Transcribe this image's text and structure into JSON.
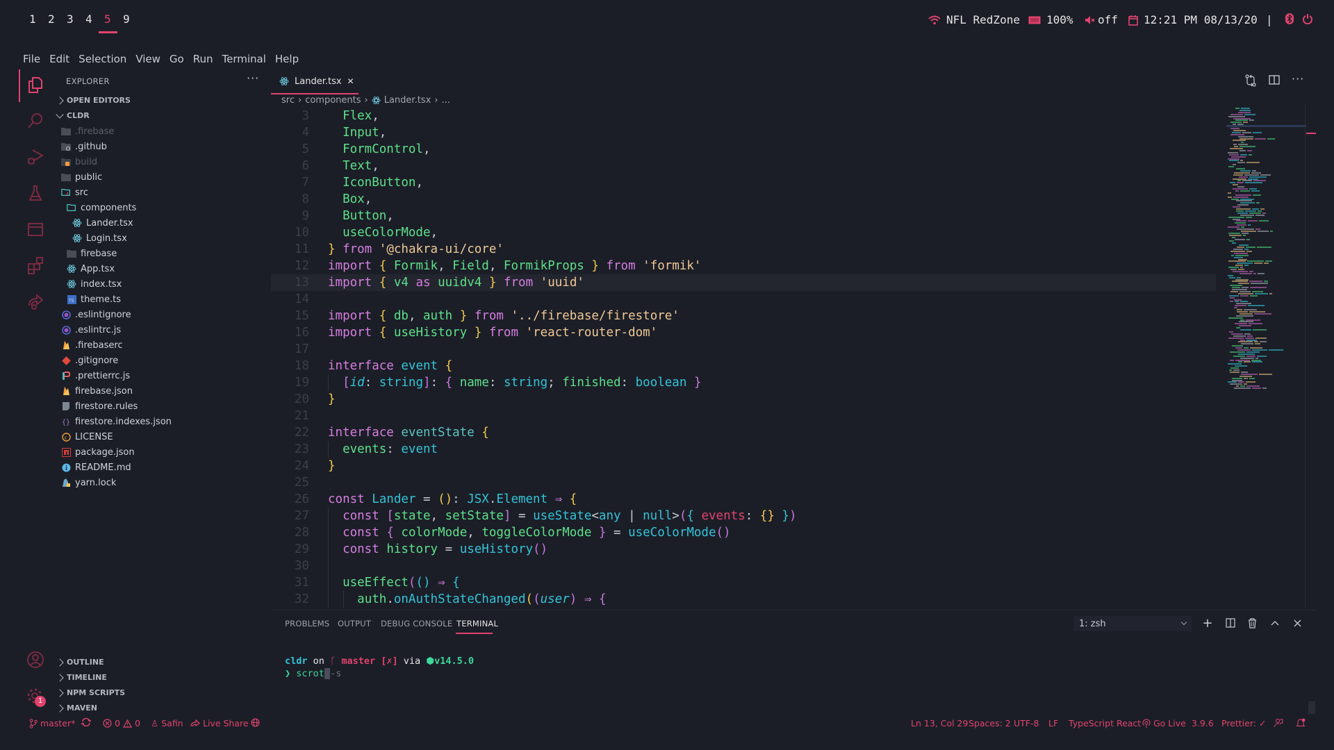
{
  "workspaces": {
    "items": [
      "1",
      "2",
      "3",
      "4",
      "5",
      "9"
    ],
    "active": "5"
  },
  "system_tray": {
    "wifi_name": "NFL RedZone",
    "battery": "100%",
    "volume": "off",
    "datetime": "12:21 PM 08/13/20",
    "separator": "|"
  },
  "menu": [
    "File",
    "Edit",
    "Selection",
    "View",
    "Go",
    "Run",
    "Terminal",
    "Help"
  ],
  "activity_bar": {
    "items": [
      "explorer",
      "search",
      "run-debug",
      "testing",
      "remote-explorer",
      "extensions",
      "live-share"
    ],
    "settings_badge": "1"
  },
  "explorer": {
    "title": "EXPLORER",
    "more": "···",
    "open_editors": "OPEN EDITORS",
    "root": "CLDR",
    "tree": [
      {
        "name": ".firebase",
        "kind": "folder",
        "dim": true
      },
      {
        "name": ".github",
        "kind": "folder-github"
      },
      {
        "name": "build",
        "kind": "folder-build",
        "dim": true
      },
      {
        "name": "public",
        "kind": "folder"
      },
      {
        "name": "src",
        "kind": "folder-src-open"
      },
      {
        "name": "components",
        "kind": "folder-open"
      },
      {
        "name": "Lander.tsx",
        "kind": "react"
      },
      {
        "name": "Login.tsx",
        "kind": "react"
      },
      {
        "name": "firebase",
        "kind": "folder"
      },
      {
        "name": "App.tsx",
        "kind": "react"
      },
      {
        "name": "index.tsx",
        "kind": "react"
      },
      {
        "name": "theme.ts",
        "kind": "typescript"
      },
      {
        "name": ".eslintignore",
        "kind": "eslint"
      },
      {
        "name": ".eslintrc.js",
        "kind": "eslint"
      },
      {
        "name": ".firebaserc",
        "kind": "firebase"
      },
      {
        "name": ".gitignore",
        "kind": "git"
      },
      {
        "name": ".prettierrc.js",
        "kind": "prettier"
      },
      {
        "name": "firebase.json",
        "kind": "firebase"
      },
      {
        "name": "firestore.rules",
        "kind": "file"
      },
      {
        "name": "firestore.indexes.json",
        "kind": "json"
      },
      {
        "name": "LICENSE",
        "kind": "license"
      },
      {
        "name": "package.json",
        "kind": "npm"
      },
      {
        "name": "README.md",
        "kind": "info"
      },
      {
        "name": "yarn.lock",
        "kind": "yarn"
      }
    ],
    "bottom_sections": [
      "OUTLINE",
      "TIMELINE",
      "NPM SCRIPTS",
      "MAVEN"
    ]
  },
  "editor": {
    "tab": {
      "label": "Lander.tsx",
      "close": "✕"
    },
    "breadcrumb": [
      "src",
      "components",
      "Lander.tsx",
      "..."
    ],
    "current_line": 13,
    "lines": [
      {
        "n": "3",
        "tokens": [
          [
            "g",
            "  Flex"
          ],
          [
            "p",
            ","
          ]
        ]
      },
      {
        "n": "4",
        "tokens": [
          [
            "g",
            "  Input"
          ],
          [
            "p",
            ","
          ]
        ]
      },
      {
        "n": "5",
        "tokens": [
          [
            "g",
            "  FormControl"
          ],
          [
            "p",
            ","
          ]
        ]
      },
      {
        "n": "6",
        "tokens": [
          [
            "g",
            "  Text"
          ],
          [
            "p",
            ","
          ]
        ]
      },
      {
        "n": "7",
        "tokens": [
          [
            "g",
            "  IconButton"
          ],
          [
            "p",
            ","
          ]
        ]
      },
      {
        "n": "8",
        "tokens": [
          [
            "g",
            "  Box"
          ],
          [
            "p",
            ","
          ]
        ]
      },
      {
        "n": "9",
        "tokens": [
          [
            "g",
            "  Button"
          ],
          [
            "p",
            ","
          ]
        ]
      },
      {
        "n": "10",
        "tokens": [
          [
            "g",
            "  useColorMode"
          ],
          [
            "p",
            ","
          ]
        ]
      },
      {
        "n": "11",
        "tokens": [
          [
            "b",
            "}"
          ],
          [
            "p",
            " "
          ],
          [
            "k",
            "from"
          ],
          [
            "p",
            " "
          ],
          [
            "s",
            "'@chakra-ui/core'"
          ]
        ]
      },
      {
        "n": "12",
        "tokens": [
          [
            "k",
            "import"
          ],
          [
            "p",
            " "
          ],
          [
            "b",
            "{"
          ],
          [
            "p",
            " "
          ],
          [
            "g",
            "Formik"
          ],
          [
            "p",
            ", "
          ],
          [
            "g",
            "Field"
          ],
          [
            "p",
            ", "
          ],
          [
            "g",
            "FormikProps"
          ],
          [
            "p",
            " "
          ],
          [
            "b",
            "}"
          ],
          [
            "p",
            " "
          ],
          [
            "k",
            "from"
          ],
          [
            "p",
            " "
          ],
          [
            "s",
            "'formik'"
          ]
        ]
      },
      {
        "n": "13",
        "tokens": [
          [
            "k",
            "import"
          ],
          [
            "p",
            " "
          ],
          [
            "b",
            "{"
          ],
          [
            "p",
            " "
          ],
          [
            "g",
            "v4"
          ],
          [
            "p",
            " "
          ],
          [
            "k",
            "as"
          ],
          [
            "p",
            " "
          ],
          [
            "g",
            "uuidv4"
          ],
          [
            "p",
            " "
          ],
          [
            "b",
            "}"
          ],
          [
            "p",
            " "
          ],
          [
            "k",
            "from"
          ],
          [
            "p",
            " "
          ],
          [
            "s",
            "'uuid'"
          ]
        ]
      },
      {
        "n": "14",
        "tokens": []
      },
      {
        "n": "15",
        "tokens": [
          [
            "k",
            "import"
          ],
          [
            "p",
            " "
          ],
          [
            "b",
            "{"
          ],
          [
            "p",
            " "
          ],
          [
            "g",
            "db"
          ],
          [
            "p",
            ", "
          ],
          [
            "g",
            "auth"
          ],
          [
            "p",
            " "
          ],
          [
            "b",
            "}"
          ],
          [
            "p",
            " "
          ],
          [
            "k",
            "from"
          ],
          [
            "p",
            " "
          ],
          [
            "s",
            "'../firebase/firestore'"
          ]
        ]
      },
      {
        "n": "16",
        "tokens": [
          [
            "k",
            "import"
          ],
          [
            "p",
            " "
          ],
          [
            "b",
            "{"
          ],
          [
            "p",
            " "
          ],
          [
            "g",
            "useHistory"
          ],
          [
            "p",
            " "
          ],
          [
            "b",
            "}"
          ],
          [
            "p",
            " "
          ],
          [
            "k",
            "from"
          ],
          [
            "p",
            " "
          ],
          [
            "s",
            "'react-router-dom'"
          ]
        ]
      },
      {
        "n": "17",
        "tokens": []
      },
      {
        "n": "18",
        "tokens": [
          [
            "k",
            "interface"
          ],
          [
            "p",
            " "
          ],
          [
            "t",
            "event"
          ],
          [
            "p",
            " "
          ],
          [
            "b",
            "{"
          ]
        ]
      },
      {
        "n": "19",
        "tokens": [
          [
            "p",
            "  "
          ],
          [
            "m",
            "["
          ],
          [
            "t it",
            "id"
          ],
          [
            "p",
            ": "
          ],
          [
            "t",
            "string"
          ],
          [
            "m",
            "]"
          ],
          [
            "p",
            ": "
          ],
          [
            "m",
            "{"
          ],
          [
            "p",
            " "
          ],
          [
            "g",
            "name"
          ],
          [
            "p",
            ": "
          ],
          [
            "t",
            "string"
          ],
          [
            "p",
            "; "
          ],
          [
            "g",
            "finished"
          ],
          [
            "p",
            ": "
          ],
          [
            "t",
            "boolean"
          ],
          [
            "p",
            " "
          ],
          [
            "m",
            "}"
          ]
        ]
      },
      {
        "n": "20",
        "tokens": [
          [
            "b",
            "}"
          ]
        ]
      },
      {
        "n": "21",
        "tokens": []
      },
      {
        "n": "22",
        "tokens": [
          [
            "k",
            "interface"
          ],
          [
            "p",
            " "
          ],
          [
            "tc",
            "eventState"
          ],
          [
            "p",
            " "
          ],
          [
            "b",
            "{"
          ]
        ]
      },
      {
        "n": "23",
        "tokens": [
          [
            "g",
            "  events"
          ],
          [
            "p",
            ": "
          ],
          [
            "t",
            "event"
          ]
        ]
      },
      {
        "n": "24",
        "tokens": [
          [
            "b",
            "}"
          ]
        ]
      },
      {
        "n": "25",
        "tokens": []
      },
      {
        "n": "26",
        "tokens": [
          [
            "k",
            "const"
          ],
          [
            "p",
            " "
          ],
          [
            "t",
            "Lander"
          ],
          [
            "p",
            " = "
          ],
          [
            "b",
            "()"
          ],
          [
            "p",
            ": "
          ],
          [
            "t",
            "JSX"
          ],
          [
            "p",
            "."
          ],
          [
            "t",
            "Element"
          ],
          [
            "p",
            " "
          ],
          [
            "k",
            "⇒"
          ],
          [
            "p",
            " "
          ],
          [
            "b",
            "{"
          ]
        ]
      },
      {
        "n": "27",
        "tokens": [
          [
            "p",
            "  "
          ],
          [
            "k",
            "const"
          ],
          [
            "p",
            " "
          ],
          [
            "m",
            "["
          ],
          [
            "g",
            "state"
          ],
          [
            "p",
            ", "
          ],
          [
            "g",
            "setState"
          ],
          [
            "m",
            "]"
          ],
          [
            "p",
            " = "
          ],
          [
            "t",
            "useState"
          ],
          [
            "p",
            "<"
          ],
          [
            "t",
            "any"
          ],
          [
            "p",
            " | "
          ],
          [
            "t",
            "null"
          ],
          [
            "p",
            ">"
          ],
          [
            "m",
            "("
          ],
          [
            "t",
            "{"
          ],
          [
            "p",
            " "
          ],
          [
            "r",
            "events"
          ],
          [
            "p",
            ": "
          ],
          [
            "b",
            "{}"
          ],
          [
            "p",
            " "
          ],
          [
            "t",
            "}"
          ],
          [
            "m",
            ")"
          ]
        ]
      },
      {
        "n": "28",
        "tokens": [
          [
            "p",
            "  "
          ],
          [
            "k",
            "const"
          ],
          [
            "p",
            " "
          ],
          [
            "m",
            "{"
          ],
          [
            "p",
            " "
          ],
          [
            "g",
            "colorMode"
          ],
          [
            "p",
            ", "
          ],
          [
            "g",
            "toggleColorMode"
          ],
          [
            "p",
            " "
          ],
          [
            "m",
            "}"
          ],
          [
            "p",
            " = "
          ],
          [
            "t",
            "useColorMode"
          ],
          [
            "m",
            "()"
          ]
        ]
      },
      {
        "n": "29",
        "tokens": [
          [
            "p",
            "  "
          ],
          [
            "k",
            "const"
          ],
          [
            "p",
            " "
          ],
          [
            "g",
            "history"
          ],
          [
            "p",
            " = "
          ],
          [
            "t",
            "useHistory"
          ],
          [
            "m",
            "()"
          ]
        ]
      },
      {
        "n": "30",
        "tokens": []
      },
      {
        "n": "31",
        "tokens": [
          [
            "p",
            "  "
          ],
          [
            "g",
            "useEffect"
          ],
          [
            "m",
            "("
          ],
          [
            "t",
            "()"
          ],
          [
            "p",
            " "
          ],
          [
            "k",
            "⇒"
          ],
          [
            "p",
            " "
          ],
          [
            "t",
            "{"
          ]
        ]
      },
      {
        "n": "32",
        "tokens": [
          [
            "p",
            "    "
          ],
          [
            "g",
            "auth"
          ],
          [
            "p",
            "."
          ],
          [
            "t",
            "onAuthStateChanged"
          ],
          [
            "b",
            "("
          ],
          [
            "m",
            "("
          ],
          [
            "t it",
            "user"
          ],
          [
            "m",
            ")"
          ],
          [
            "p",
            " "
          ],
          [
            "k",
            "⇒"
          ],
          [
            "p",
            " "
          ],
          [
            "m",
            "{"
          ]
        ]
      }
    ]
  },
  "panel": {
    "tabs": [
      "PROBLEMS",
      "OUTPUT",
      "DEBUG CONSOLE",
      "TERMINAL"
    ],
    "active_tab": "TERMINAL",
    "terminal_select": "1: zsh",
    "prompt": {
      "dir": "cldr",
      "on": "on",
      "branch_icon": "",
      "branch": "master",
      "git_status": "[✗]",
      "via": "via",
      "node_icon": "⬢",
      "node_version": "v14.5.0",
      "arrow": "❯",
      "command": "scrot",
      "args": "-s"
    }
  },
  "status_bar": {
    "left": {
      "branch": "master*",
      "errors": "0",
      "warnings": "0",
      "user": "Safin",
      "live_share": "Live Share"
    },
    "right": {
      "position": "Ln 13, Col 29",
      "spaces": "Spaces: 2",
      "encoding": "UTF-8",
      "eol": "LF",
      "language": "TypeScript React",
      "go_live": "Go Live",
      "ts_version": "3.9.6",
      "prettier": "Prettier: ✓"
    }
  },
  "colors": {
    "accent": "#e2436e",
    "background": "#1b1e27"
  }
}
